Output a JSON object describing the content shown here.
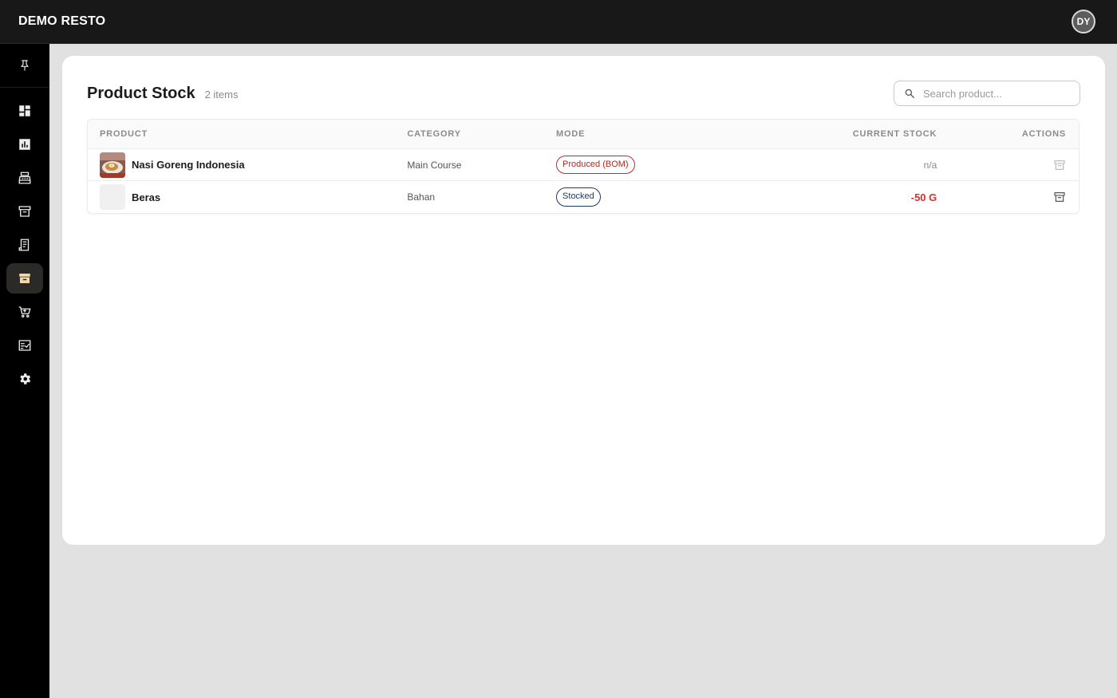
{
  "app": {
    "brand": "DEMO RESTO",
    "user_initials": "DY"
  },
  "sidebar": {
    "pin_icon": "pin-icon",
    "items": [
      {
        "id": "dashboard",
        "icon": "dashboard-icon",
        "active": false
      },
      {
        "id": "reports",
        "icon": "bar-chart-icon",
        "active": false
      },
      {
        "id": "pos",
        "icon": "cash-register-icon",
        "active": false
      },
      {
        "id": "inventory",
        "icon": "archive-icon",
        "active": false
      },
      {
        "id": "receipts",
        "icon": "receipt-icon",
        "active": false
      },
      {
        "id": "product-stock",
        "icon": "archive-box-icon",
        "active": true
      },
      {
        "id": "purchasing",
        "icon": "shopping-cart-icon",
        "active": false
      },
      {
        "id": "checklist",
        "icon": "checklist-icon",
        "active": false
      },
      {
        "id": "settings",
        "icon": "gear-icon",
        "active": false
      }
    ]
  },
  "page": {
    "title": "Product Stock",
    "count_label": "2 items",
    "search_placeholder": "Search product..."
  },
  "table": {
    "headers": {
      "product": "PRODUCT",
      "category": "CATEGORY",
      "mode": "MODE",
      "stock": "CURRENT STOCK",
      "actions": "ACTIONS"
    },
    "rows": [
      {
        "name": "Nasi Goreng Indonesia",
        "category": "Main Course",
        "mode": "Produced (BOM)",
        "stock": "n/a",
        "has_image": true
      },
      {
        "name": "Beras",
        "category": "Bahan",
        "mode": "Stocked",
        "stock": "-50 G",
        "has_image": false
      }
    ]
  },
  "colors": {
    "topbar": "#181818",
    "sidebar": "#000000",
    "active_nav": "#2c2a27",
    "active_icon": "#f4d9a8",
    "bom_badge": "#c62828",
    "stocked_badge": "#1d3a5f",
    "negative_stock": "#d32f2f"
  }
}
